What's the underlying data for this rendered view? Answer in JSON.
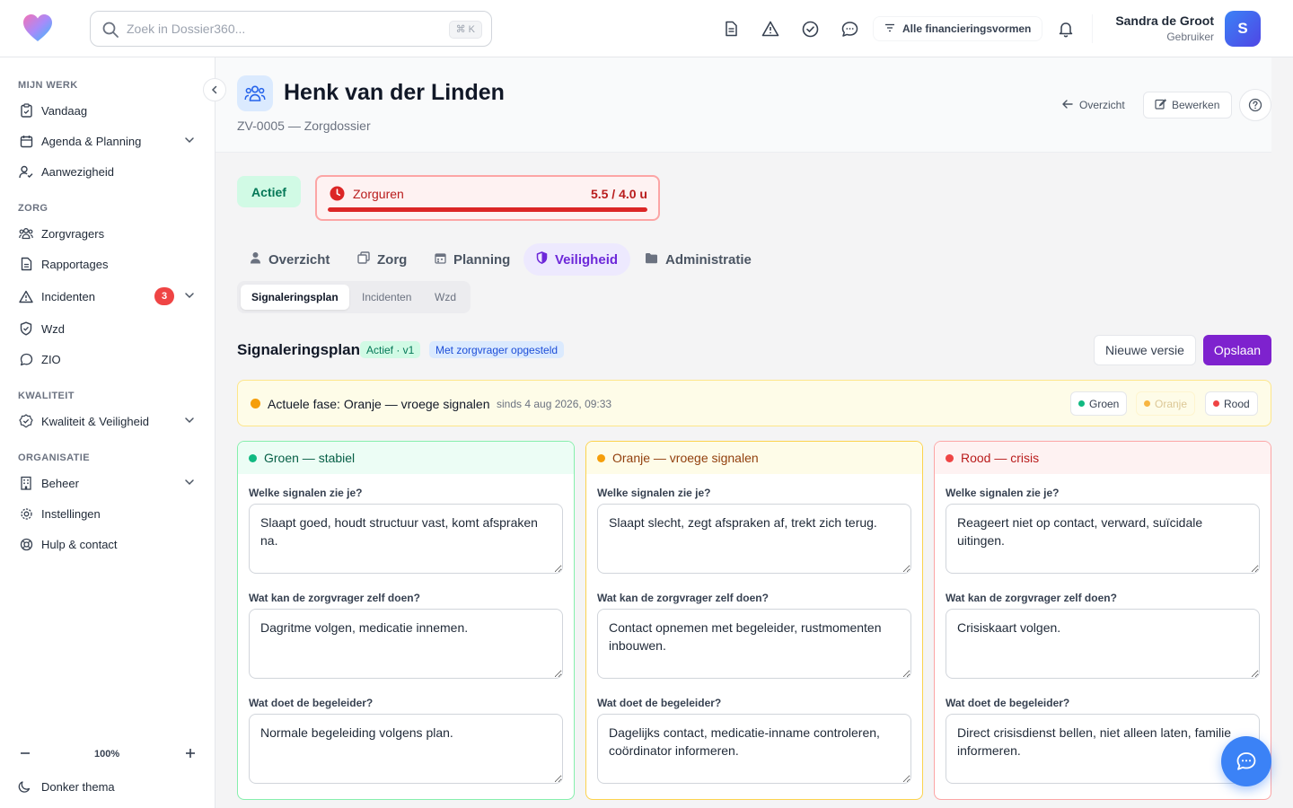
{
  "search": {
    "placeholder": "Zoek in Dossier360...",
    "shortcut": "⌘ K"
  },
  "topbar": {
    "financing_label": "Alle financieringsvormen",
    "icons": [
      "document-icon",
      "alert-triangle-icon",
      "check-circle-icon",
      "chat-icon",
      "filter-icon",
      "bell-icon"
    ],
    "user_name": "Sandra de Groot",
    "user_role": "Gebruiker",
    "avatar_initial": "S"
  },
  "sidebar": {
    "sections": [
      "MIJN WERK",
      "ZORG",
      "KWALITEIT",
      "ORGANISATIE"
    ],
    "items": [
      {
        "label": "Vandaag"
      },
      {
        "label": "Agenda & Planning"
      },
      {
        "label": "Aanwezigheid"
      },
      {
        "label": "Zorgvragers"
      },
      {
        "label": "Rapportages"
      },
      {
        "label": "Incidenten",
        "badge": "3"
      },
      {
        "label": "Wzd"
      },
      {
        "label": "ZIO"
      },
      {
        "label": "Kwaliteit & Veiligheid"
      },
      {
        "label": "Beheer"
      },
      {
        "label": "Instellingen"
      },
      {
        "label": "Hulp & contact"
      }
    ],
    "zoom": "100%",
    "dark_theme": "Donker thema"
  },
  "header": {
    "title": "Henk van der Linden",
    "subtitle": "ZV-0005 — Zorgdossier",
    "back_label": "Overzicht",
    "edit_label": "Bewerken"
  },
  "status": {
    "label": "Actief",
    "hours_label": "Zorguren",
    "hours_value": "5.5 / 4.0 u",
    "hours_used": 5.5,
    "hours_budget": 4.0
  },
  "tabs": [
    {
      "label": "Overzicht",
      "active": false
    },
    {
      "label": "Zorg",
      "active": false
    },
    {
      "label": "Planning",
      "active": false
    },
    {
      "label": "Veiligheid",
      "active": true
    },
    {
      "label": "Administratie",
      "active": false
    }
  ],
  "subtabs": [
    {
      "label": "Signaleringsplan",
      "active": true
    },
    {
      "label": "Incidenten",
      "active": false
    },
    {
      "label": "Wzd",
      "active": false
    }
  ],
  "plan": {
    "title": "Signaleringsplan",
    "version_pill": "Actief · v1",
    "made_with_pill": "Met zorgvrager opgesteld",
    "new_version_label": "Nieuwe versie",
    "save_label": "Opslaan",
    "phase_text": "Actuele fase: Oranje — vroege signalen",
    "phase_since": "sinds 4 aug 2026, 09:33",
    "phase_buttons": [
      "Groen",
      "Oranje",
      "Rood"
    ],
    "colors": {
      "green": "#10b981",
      "orange": "#f59e0b",
      "red": "#ef4444"
    },
    "questions": [
      "Welke signalen zie je?",
      "Wat kan de zorgvrager zelf doen?",
      "Wat doet de begeleider?"
    ],
    "columns": [
      {
        "title": "Groen — stabiel",
        "answers": [
          "Slaapt goed, houdt structuur vast, komt afspraken na.",
          "Dagritme volgen, medicatie innemen.",
          "Normale begeleiding volgens plan."
        ]
      },
      {
        "title": "Oranje — vroege signalen",
        "answers": [
          "Slaapt slecht, zegt afspraken af, trekt zich terug.",
          "Contact opnemen met begeleider, rustmomenten inbouwen.",
          "Dagelijks contact, medicatie-inname controleren, coördinator informeren."
        ]
      },
      {
        "title": "Rood — crisis",
        "answers": [
          "Reageert niet op contact, verward, suïcidale uitingen.",
          "Crisiskaart volgen.",
          "Direct crisisdienst bellen, niet alleen laten, familie informeren."
        ]
      }
    ]
  }
}
